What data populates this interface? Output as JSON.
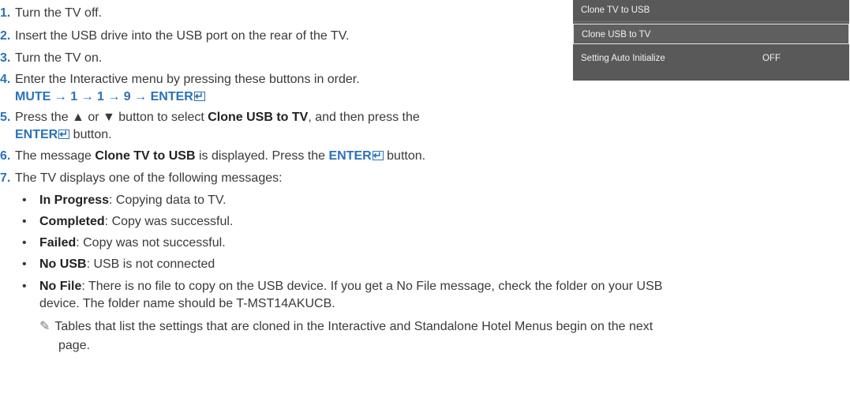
{
  "menu": {
    "items": [
      {
        "label": "Clone TV to USB",
        "value": ""
      },
      {
        "label": "Clone USB to TV",
        "value": ""
      },
      {
        "label": "Setting Auto Initialize",
        "value": "OFF"
      }
    ]
  },
  "steps": [
    {
      "num": "1.",
      "text": "Turn the TV off."
    },
    {
      "num": "2.",
      "text": "Insert the USB drive into the USB port on the rear of the TV."
    },
    {
      "num": "3.",
      "text": "Turn the TV on."
    },
    {
      "num": "4.",
      "text": "Enter the Interactive menu by pressing these buttons in order.",
      "sequence": "MUTE → 1 → 1 → 9 → ENTER"
    },
    {
      "num": "5.",
      "text_a": "Press the ▲ or ▼ button to select ",
      "bold_a": "Clone USB to TV",
      "text_b": ", and then press the",
      "key": "ENTER",
      "text_c": " button."
    },
    {
      "num": "6.",
      "text_a": "The message ",
      "bold_a": "Clone TV to USB",
      "text_b": " is displayed. Press the ",
      "key": "ENTER",
      "text_c": " button."
    },
    {
      "num": "7.",
      "text": "The TV displays one of the following messages:"
    }
  ],
  "bullets": [
    {
      "term": "In Progress",
      "desc": ": Copying data to TV."
    },
    {
      "term": "Completed",
      "desc": ": Copy was successful."
    },
    {
      "term": "Failed",
      "desc": ": Copy was not successful."
    },
    {
      "term": "No USB",
      "desc": ": USB is not connected"
    },
    {
      "term": "No File",
      "desc": ": There is no file to copy on the USB device. If you get a No File message, check the folder on your USB",
      "desc2": "device. The folder name should be T-MST14AKUCB."
    }
  ],
  "note": {
    "line1": "Tables that list the settings that are cloned in the Interactive and Standalone Hotel Menus begin on the next",
    "line2": "page."
  }
}
